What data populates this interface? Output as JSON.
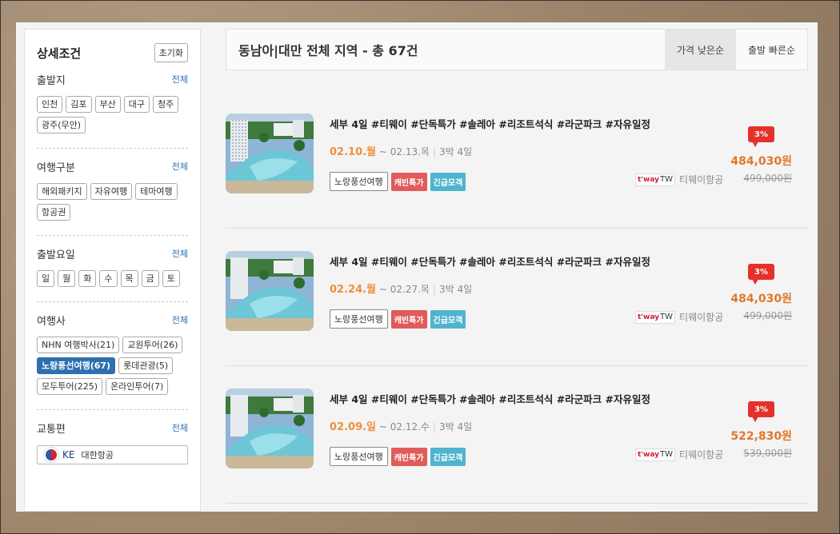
{
  "sidebar": {
    "title": "상세조건",
    "reset_label": "초기화",
    "all_label": "전체",
    "sections": [
      {
        "title": "출발지",
        "chips": [
          "인천",
          "김포",
          "부산",
          "대구",
          "청주",
          "광주(무안)"
        ]
      },
      {
        "title": "여행구분",
        "chips": [
          "해외패키지",
          "자유여행",
          "테마여행",
          "항공권"
        ]
      },
      {
        "title": "출발요일",
        "chips": [
          "일",
          "월",
          "화",
          "수",
          "목",
          "금",
          "토"
        ]
      },
      {
        "title": "여행사",
        "chips": [
          "NHN 여행박사(21)",
          "교원투어(26)",
          "노랑풍선여행(67)",
          "롯데관광(5)",
          "모두투어(225)",
          "온라인투어(7)"
        ],
        "active": "노랑풍선여행(67)"
      },
      {
        "title": "교통편"
      }
    ],
    "airline_filter": {
      "code": "KE",
      "name": "대한항공"
    }
  },
  "header": {
    "title": "동남아|대만 전체 지역 - 총 67건",
    "sort_options": [
      "가격 낮은순",
      "출발 빠른순"
    ],
    "active_sort": "가격 낮은순"
  },
  "products": [
    {
      "title": "세부 4일 #티웨이 #단독특가 #솔레아 #리조트석식 #라군파크 #자유일정",
      "date_start": "02.10.월",
      "date_end": "~ 02.13.목",
      "duration": "3박 4일",
      "tags": [
        "노랑풍선여행",
        "캐빈특가",
        "긴급모객"
      ],
      "airline": "티웨이항공",
      "airline_logo": "t'way",
      "airline_logo_suffix": "TW",
      "discount": "3%",
      "price": "484,030원",
      "original_price": "499,000원"
    },
    {
      "title": "세부 4일 #티웨이 #단독특가 #솔레아 #리조트석식 #라군파크 #자유일정",
      "date_start": "02.24.월",
      "date_end": "~ 02.27.목",
      "duration": "3박 4일",
      "tags": [
        "노랑풍선여행",
        "캐빈특가",
        "긴급모객"
      ],
      "airline": "티웨이항공",
      "airline_logo": "t'way",
      "airline_logo_suffix": "TW",
      "discount": "3%",
      "price": "484,030원",
      "original_price": "499,000원"
    },
    {
      "title": "세부 4일 #티웨이 #단독특가 #솔레아 #리조트석식 #라군파크 #자유일정",
      "date_start": "02.09.일",
      "date_end": "~ 02.12.수",
      "duration": "3박 4일",
      "tags": [
        "노랑풍선여행",
        "캐빈특가",
        "긴급모객"
      ],
      "airline": "티웨이항공",
      "airline_logo": "t'way",
      "airline_logo_suffix": "TW",
      "discount": "3%",
      "price": "522,830원",
      "original_price": "539,000원"
    }
  ],
  "colors": {
    "accent_orange": "#e0782b",
    "date_orange": "#f0903c",
    "active_blue": "#2f6fb0",
    "discount_red": "#e4322b",
    "tag_red": "#e05c5c",
    "tag_blue": "#4fb4cf"
  }
}
